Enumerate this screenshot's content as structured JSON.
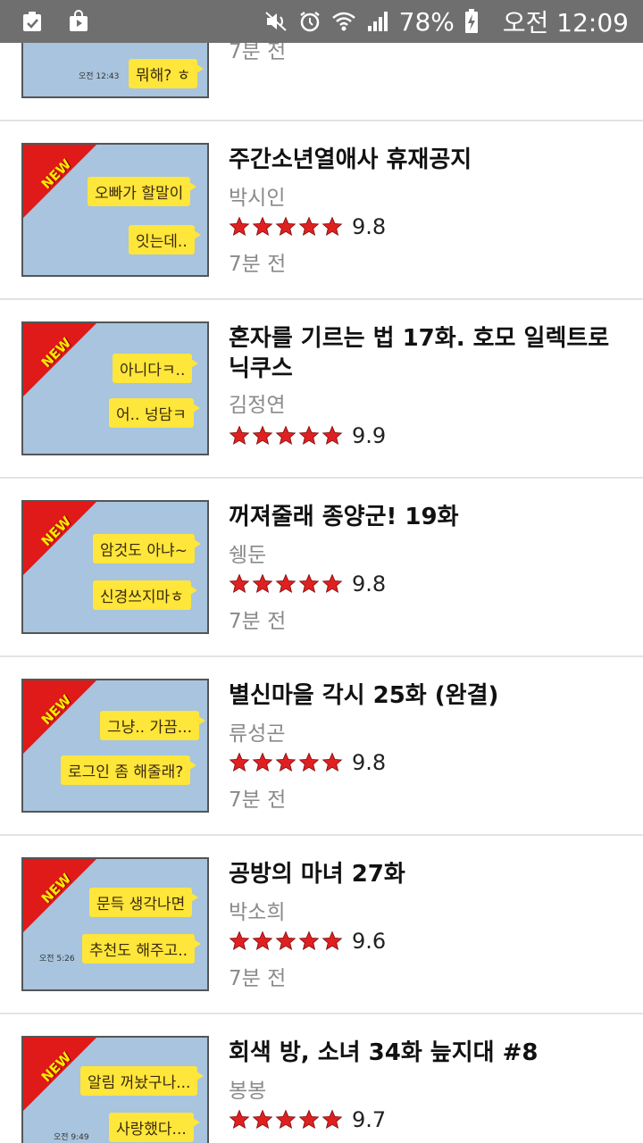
{
  "status_bar": {
    "battery": "78%",
    "clock": "오전 12:09"
  },
  "colors": {
    "star": "#e02020",
    "ribbon": "#e01919",
    "thumb_bg": "#a8c4de",
    "bubble": "#ffe63a"
  },
  "items": [
    {
      "title": "",
      "author": "",
      "score": "",
      "time": "7분 전",
      "new": false,
      "bubbles": [
        "뭐해? ㅎ"
      ],
      "bubble_time": "오전 12:43"
    },
    {
      "title": "주간소년열애사 휴재공지",
      "author": "박시인",
      "score": "9.8",
      "time": "7분 전",
      "new": true,
      "bubbles": [
        "오빠가 할말이",
        "잇는데.."
      ]
    },
    {
      "title": "혼자를 기르는 법 17화. 호모 일렉트로닉쿠스",
      "author": "김정연",
      "score": "9.9",
      "time": "",
      "new": true,
      "bubbles": [
        "아니다ㅋ..",
        "어.. 넝담ㅋ"
      ]
    },
    {
      "title": "꺼져줄래 종양군! 19화",
      "author": "쉥둔",
      "score": "9.8",
      "time": "7분 전",
      "new": true,
      "bubbles": [
        "암것도 아냐~",
        "신경쓰지마ㅎ"
      ]
    },
    {
      "title": "별신마을 각시 25화 (완결)",
      "author": "류성곤",
      "score": "9.8",
      "time": "7분 전",
      "new": true,
      "bubbles": [
        "그냥.. 가끔...",
        "로그인 좀 해줄래?"
      ]
    },
    {
      "title": "공방의 마녀 27화",
      "author": "박소희",
      "score": "9.6",
      "time": "7분 전",
      "new": true,
      "bubbles": [
        "문득 생각나면",
        "추천도 해주고.."
      ],
      "bubble_time": "오전 5:26"
    },
    {
      "title": "회색 방, 소녀 34화 늪지대 #8",
      "author": "봉봉",
      "score": "9.7",
      "time": "",
      "new": true,
      "bubbles": [
        "알림 꺼놨구나...",
        "사랑했다..."
      ],
      "bubble_time": "오전 9:49"
    }
  ],
  "ribbon_label": "NEW"
}
